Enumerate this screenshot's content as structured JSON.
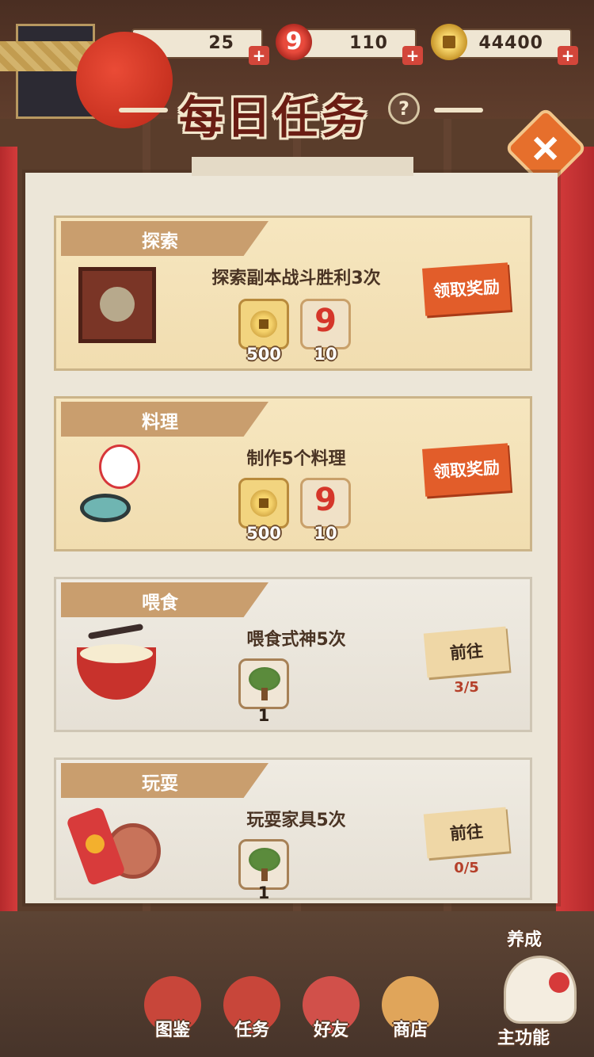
{
  "header": {
    "title": "每日任务",
    "help_label": "?",
    "close_label": "+",
    "resources": [
      {
        "icon": "ticket-icon",
        "value": "25"
      },
      {
        "icon": "nine-magatama-icon",
        "glyph": "9",
        "value": "110"
      },
      {
        "icon": "coin-icon",
        "value": "44400"
      }
    ],
    "plus_label": "+"
  },
  "tasks": [
    {
      "category": "探索",
      "description": "探索副本战斗胜利3次",
      "icon": "shrine-icon",
      "rewards": [
        {
          "icon": "coin-icon",
          "amount": "500"
        },
        {
          "icon": "nine-magatama-icon",
          "glyph": "9",
          "amount": "10"
        }
      ],
      "action_label": "领取奖励",
      "state": "claimable"
    },
    {
      "category": "料理",
      "description": "制作5个料理",
      "icon": "cooking-spirit-icon",
      "rewards": [
        {
          "icon": "coin-icon",
          "amount": "500"
        },
        {
          "icon": "nine-magatama-icon",
          "glyph": "9",
          "amount": "10"
        }
      ],
      "action_label": "领取奖励",
      "state": "claimable"
    },
    {
      "category": "喂食",
      "description": "喂食式神5次",
      "icon": "ramen-bowl-icon",
      "rewards": [
        {
          "icon": "bonsai-tree-icon",
          "amount": "1"
        }
      ],
      "action_label": "前往",
      "progress": "3/5",
      "state": "in-progress"
    },
    {
      "category": "玩耍",
      "description": "玩耍家具5次",
      "icon": "toy-icon",
      "rewards": [
        {
          "icon": "bonsai-tree-icon",
          "amount": "1"
        }
      ],
      "action_label": "前往",
      "progress": "0/5",
      "state": "in-progress"
    }
  ],
  "bottom_nav": [
    {
      "label": "图鉴",
      "icon": "book-eye-icon",
      "color": "#c8463a"
    },
    {
      "label": "任务",
      "icon": "task-scroll-icon",
      "color": "#c8463a"
    },
    {
      "label": "好友",
      "icon": "friends-icon",
      "color": "#d1504a"
    },
    {
      "label": "商店",
      "icon": "lucky-cat-icon",
      "color": "#e0a55a"
    }
  ],
  "side_labels": {
    "nurture": "养成",
    "main_function": "主功能"
  },
  "colors": {
    "claim_button": "#e25d2a",
    "go_button": "#efd7a6",
    "progress_text": "#b5402a",
    "title": "#6a1d14"
  }
}
